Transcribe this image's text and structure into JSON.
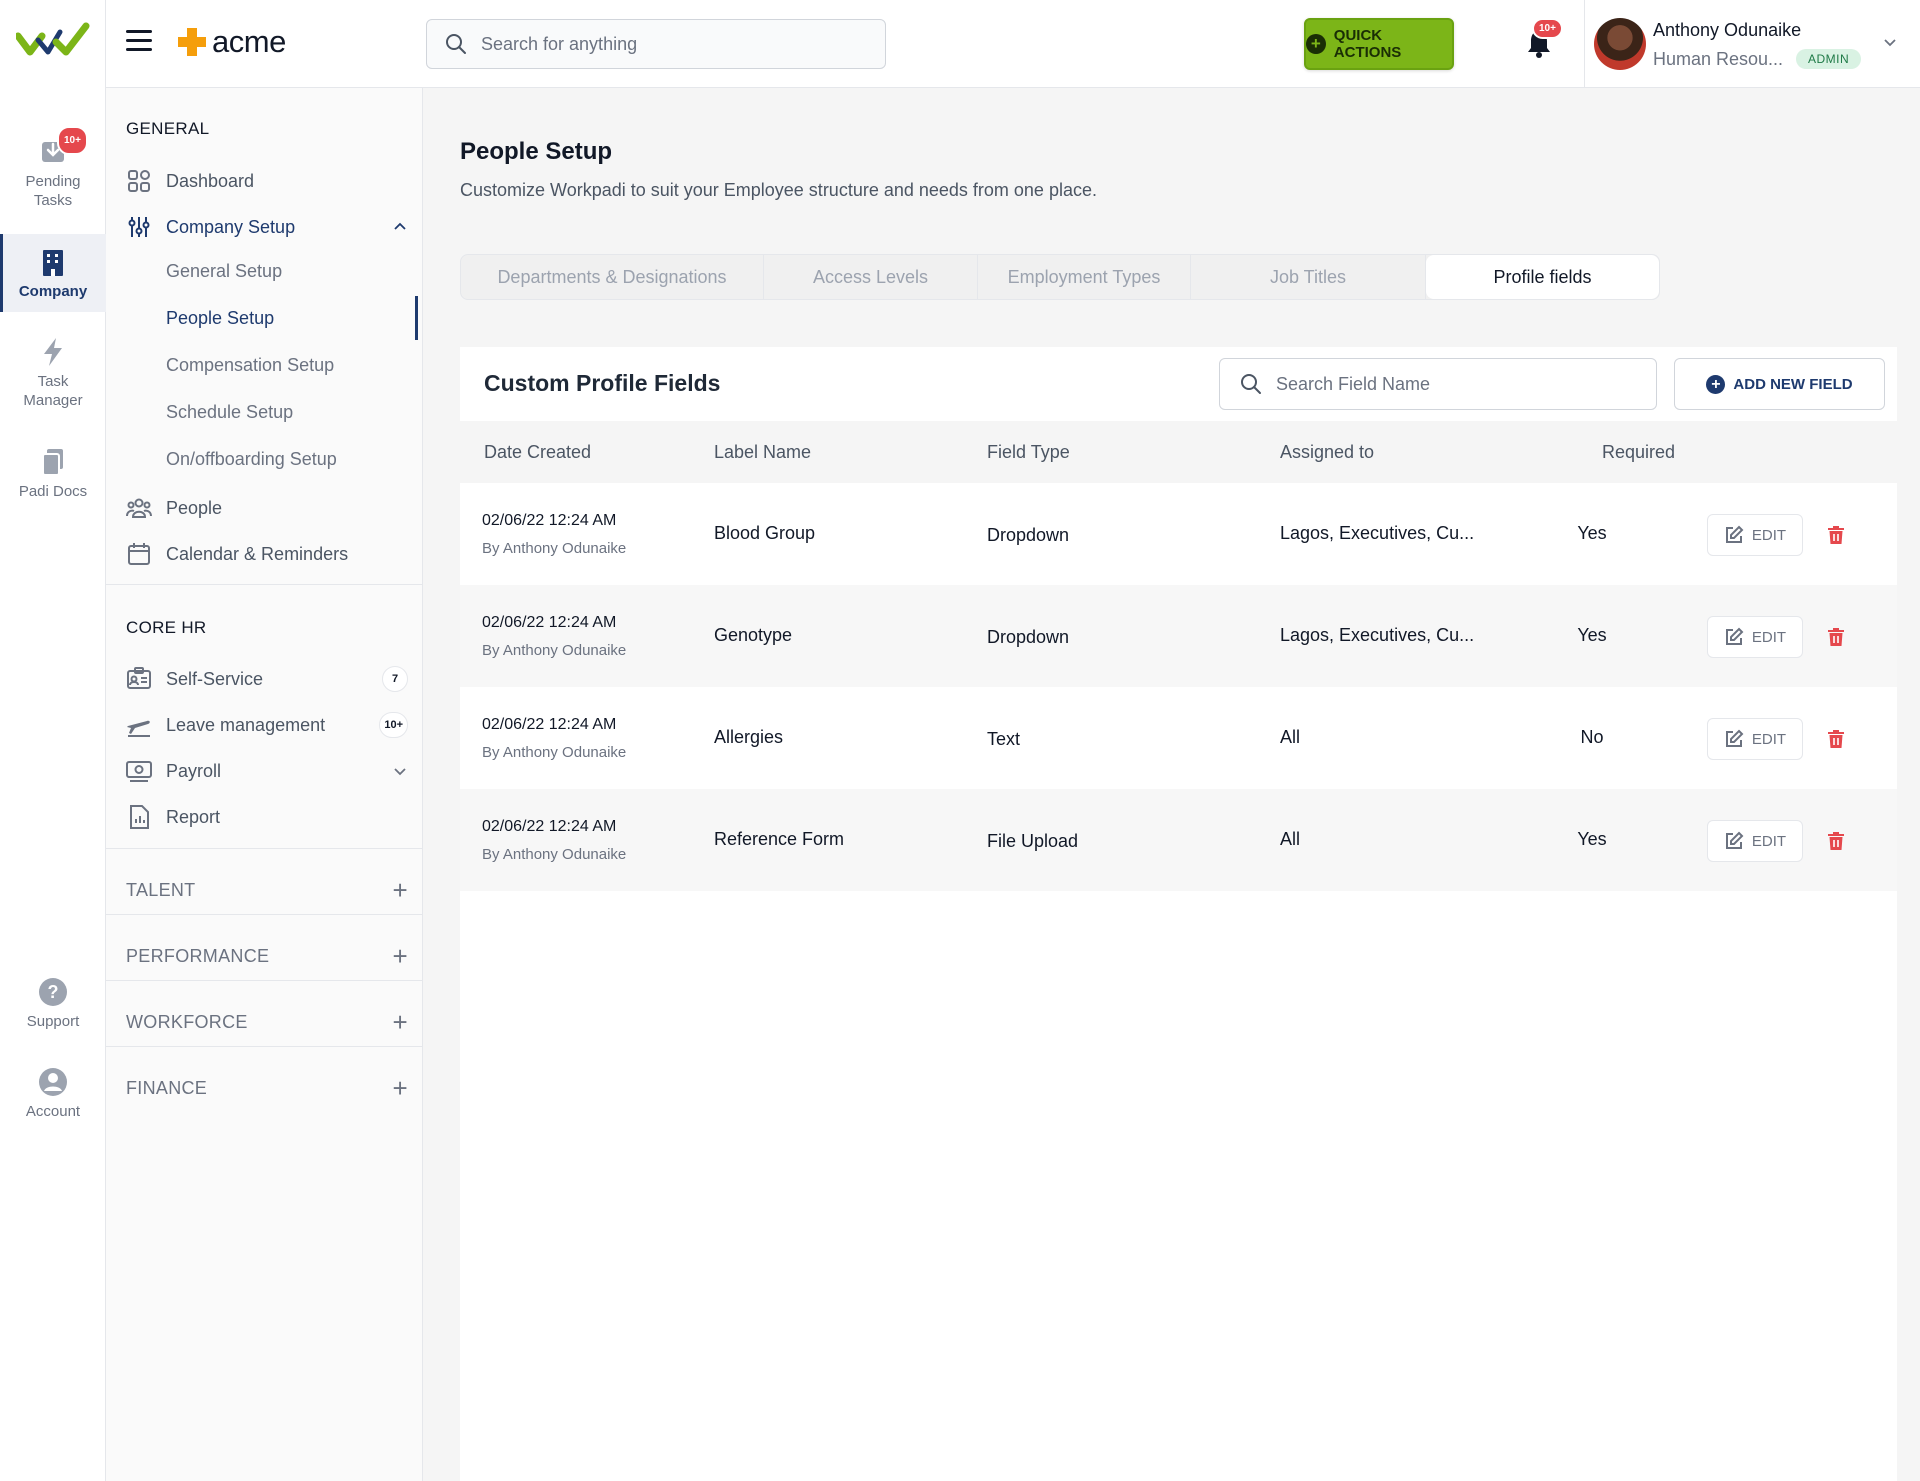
{
  "rail": {
    "items": [
      {
        "label": "Pending Tasks",
        "icon": "inbox-download-icon",
        "badge": "10+"
      },
      {
        "label": "Company",
        "icon": "building-icon"
      },
      {
        "label": "Task Manager",
        "icon": "lightning-icon"
      },
      {
        "label": "Padi Docs",
        "icon": "documents-icon"
      },
      {
        "label": "Support",
        "icon": "help-circle-icon"
      },
      {
        "label": "Account",
        "icon": "user-circle-icon"
      }
    ]
  },
  "topbar": {
    "brand": "acme",
    "search_placeholder": "Search for anything",
    "quick_actions": "QUICK ACTIONS",
    "notification_badge": "10+",
    "user_name": "Anthony Odunaike",
    "user_role": "Human Resou...",
    "user_badge": "ADMIN"
  },
  "sidebar": {
    "general_title": "GENERAL",
    "dashboard": "Dashboard",
    "company_setup": "Company Setup",
    "company_sub": [
      "General Setup",
      "People Setup",
      "Compensation Setup",
      "Schedule Setup",
      "On/offboarding Setup"
    ],
    "people": "People",
    "calendar": "Calendar & Reminders",
    "corehr_title": "CORE HR",
    "self_service": "Self-Service",
    "self_service_count": "7",
    "leave": "Leave management",
    "leave_count": "10+",
    "payroll": "Payroll",
    "report": "Report",
    "talent": "TALENT",
    "performance": "PERFORMANCE",
    "workforce": "WORKFORCE",
    "finance": "FINANCE"
  },
  "main": {
    "title": "People Setup",
    "subtitle": "Customize Workpadi to suit your Employee structure and needs from one place.",
    "tabs": [
      "Departments & Designations",
      "Access Levels",
      "Employment Types",
      "Job Titles",
      "Profile fields"
    ],
    "active_tab": "Profile fields",
    "card_title": "Custom Profile Fields",
    "field_search_placeholder": "Search Field Name",
    "add_button": "ADD NEW FIELD",
    "columns": [
      "Date Created",
      "Label Name",
      "Field Type",
      "Assigned to",
      "Required"
    ],
    "edit_label": "EDIT",
    "rows": [
      {
        "date": "02/06/22 12:24 AM",
        "by": "By Anthony Odunaike",
        "label": "Blood Group",
        "type": "Dropdown",
        "assigned": "Lagos, Executives, Cu...",
        "required": "Yes"
      },
      {
        "date": "02/06/22 12:24 AM",
        "by": "By Anthony Odunaike",
        "label": "Genotype",
        "type": "Dropdown",
        "assigned": "Lagos, Executives, Cu...",
        "required": "Yes"
      },
      {
        "date": "02/06/22 12:24 AM",
        "by": "By Anthony Odunaike",
        "label": "Allergies",
        "type": "Text",
        "assigned": "All",
        "required": "No"
      },
      {
        "date": "02/06/22 12:24 AM",
        "by": "By Anthony Odunaike",
        "label": "Reference Form",
        "type": "File Upload",
        "assigned": "All",
        "required": "Yes"
      }
    ]
  },
  "colors": {
    "brand_navy": "#1e3a6e",
    "brand_green": "#7cb518",
    "brand_orange": "#f59e0b",
    "danger": "#e5484d"
  }
}
